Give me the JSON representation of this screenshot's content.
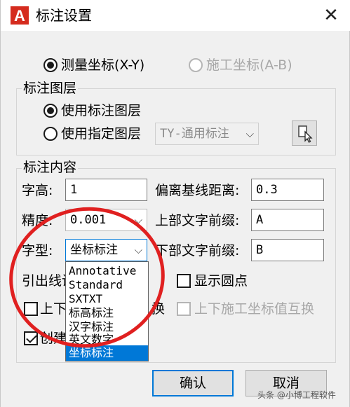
{
  "window": {
    "icon_letter": "A",
    "title": "标注设置",
    "close_glyph": "✕"
  },
  "coord_mode": {
    "survey_label": "测量坐标(X-Y)",
    "survey_checked": true,
    "construction_label": "施工坐标(A-B)",
    "construction_enabled": false
  },
  "layer_group": {
    "title": "标注图层",
    "use_label_layer": "使用标注图层",
    "use_label_layer_checked": true,
    "use_specified_layer": "使用指定图层",
    "layer_value": "TY-通用标注"
  },
  "content_group": {
    "title": "标注内容",
    "char_height_label": "字高:",
    "char_height_value": "1",
    "precision_label": "精度:",
    "precision_value": "0.001",
    "font_label": "字型:",
    "font_value": "坐标标注",
    "baseline_offset_label": "偏离基线距离:",
    "baseline_offset_value": "0.3",
    "upper_prefix_label": "上部文字前缀:",
    "upper_prefix_value": "A",
    "lower_prefix_label": "下部文字前缀:",
    "lower_prefix_value": "B",
    "leader_label": "引出线设",
    "show_dot_label": "显示圆点",
    "swap_updown_label": "上下",
    "swap_suffix_label": "换",
    "swap_construction_label": "上下施工坐标值互换",
    "create_label": "创建"
  },
  "font_dropdown": {
    "options": [
      "Annotative",
      "Standard",
      "SXTXT",
      "标高标注",
      "汉字标注",
      "英文数字",
      "坐标标注"
    ],
    "selected": "坐标标注"
  },
  "buttons": {
    "ok": "确认",
    "cancel": "取消"
  },
  "annotation_color": "#e02020",
  "accent_color": "#0078d7",
  "watermark": "头条 @小博工程软件"
}
